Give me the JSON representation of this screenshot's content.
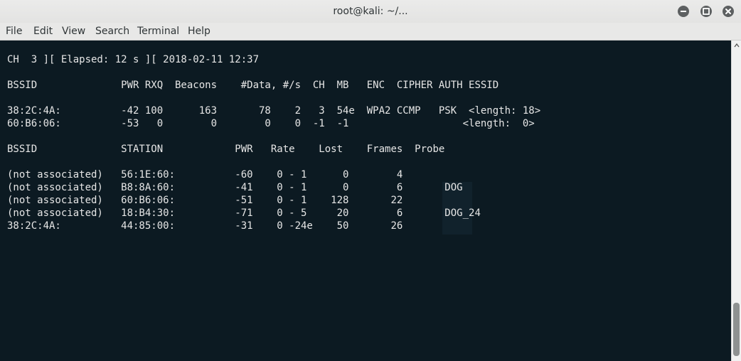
{
  "window": {
    "title": "root@kali: ~/...",
    "controls": {
      "minimize": "minimize-icon",
      "maximize": "maximize-icon",
      "close": "close-icon"
    }
  },
  "menubar": {
    "items": [
      "File",
      "Edit",
      "View",
      "Search",
      "Terminal",
      "Help"
    ]
  },
  "terminal": {
    "status_line": "CH  3 ][ Elapsed: 12 s ][ 2018-02-11 12:37",
    "ap_header": "BSSID              PWR RXQ  Beacons    #Data, #/s  CH  MB   ENC  CIPHER AUTH ESSID",
    "ap_rows": [
      "38:2C:4A:          -42 100      163       78    2   3  54e  WPA2 CCMP   PSK  <length: 18>",
      "60:B6:06:          -53   0        0        0    0  -1  -1                   <length:  0>"
    ],
    "station_header": "BSSID              STATION            PWR   Rate    Lost    Frames  Probe",
    "station_rows": [
      "(not associated)   56:1E:60:          -60    0 - 1      0        4",
      "(not associated)   B8:8A:60:          -41    0 - 1      0        6       DOG",
      "(not associated)   60:B6:06:          -51    0 - 1    128       22",
      "(not associated)   18:B4:30:          -71    0 - 5     20        6       DOG_24",
      "38:2C:4A:          44:85:00:          -31    0 -24e    50       26"
    ],
    "colors": {
      "background": "#0c1a22",
      "foreground": "#e6e6e6"
    }
  }
}
